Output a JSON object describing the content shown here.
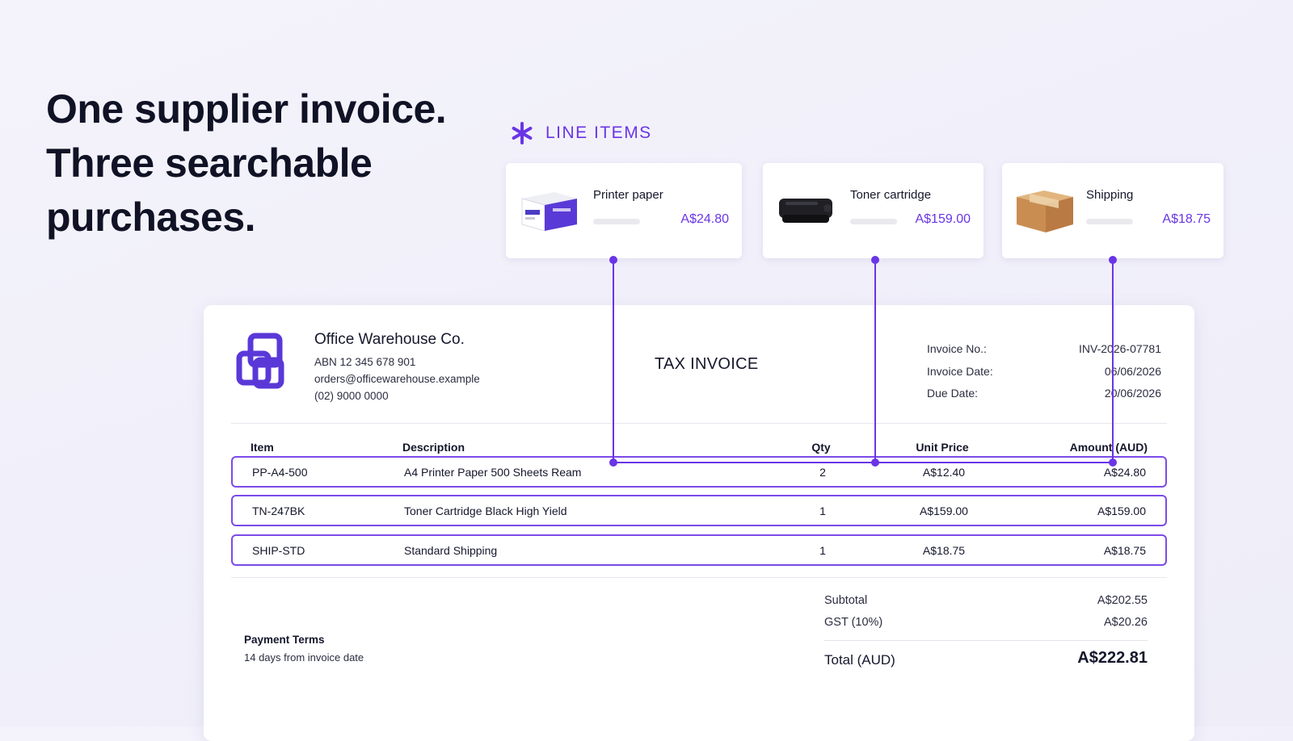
{
  "headline": [
    "One supplier invoice.",
    "Three searchable",
    "purchases."
  ],
  "line_items_label": "LINE ITEMS",
  "colors": {
    "accent": "#6a35e6",
    "row_border": "#7b4ae8",
    "text": "#15172b"
  },
  "cards": [
    {
      "name": "Printer paper",
      "price": "A$24.80",
      "icon": "printer-paper-box-icon"
    },
    {
      "name": "Toner cartridge",
      "price": "A$159.00",
      "icon": "toner-cartridge-icon"
    },
    {
      "name": "Shipping",
      "price": "A$18.75",
      "icon": "shipping-box-icon"
    }
  ],
  "invoice": {
    "company": {
      "name": "Office Warehouse Co.",
      "abn": "ABN 12 345 678 901",
      "email": "orders@officewarehouse.example",
      "phone": "(02) 9000 0000"
    },
    "doc_title": "TAX INVOICE",
    "meta": [
      {
        "label": "Invoice No.:",
        "value": "INV-2026-07781"
      },
      {
        "label": "Invoice Date:",
        "value": "06/06/2026"
      },
      {
        "label": "Due Date:",
        "value": "20/06/2026"
      }
    ],
    "columns": {
      "item": "Item",
      "description": "Description",
      "qty": "Qty",
      "unit_price": "Unit Price",
      "amount": "Amount (AUD)"
    },
    "rows": [
      {
        "item": "PP-A4-500",
        "description": "A4 Printer Paper 500 Sheets Ream",
        "qty": "2",
        "unit_price": "A$12.40",
        "amount": "A$24.80"
      },
      {
        "item": "TN-247BK",
        "description": "Toner Cartridge Black High Yield",
        "qty": "1",
        "unit_price": "A$159.00",
        "amount": "A$159.00"
      },
      {
        "item": "SHIP-STD",
        "description": "Standard Shipping",
        "qty": "1",
        "unit_price": "A$18.75",
        "amount": "A$18.75"
      }
    ],
    "payment_terms": {
      "heading": "Payment Terms",
      "value": "14 days from invoice date"
    },
    "totals": {
      "subtotal_label": "Subtotal",
      "subtotal": "A$202.55",
      "gst_label": "GST (10%)",
      "gst": "A$20.26",
      "total_label": "Total (AUD)",
      "total": "A$222.81"
    }
  }
}
